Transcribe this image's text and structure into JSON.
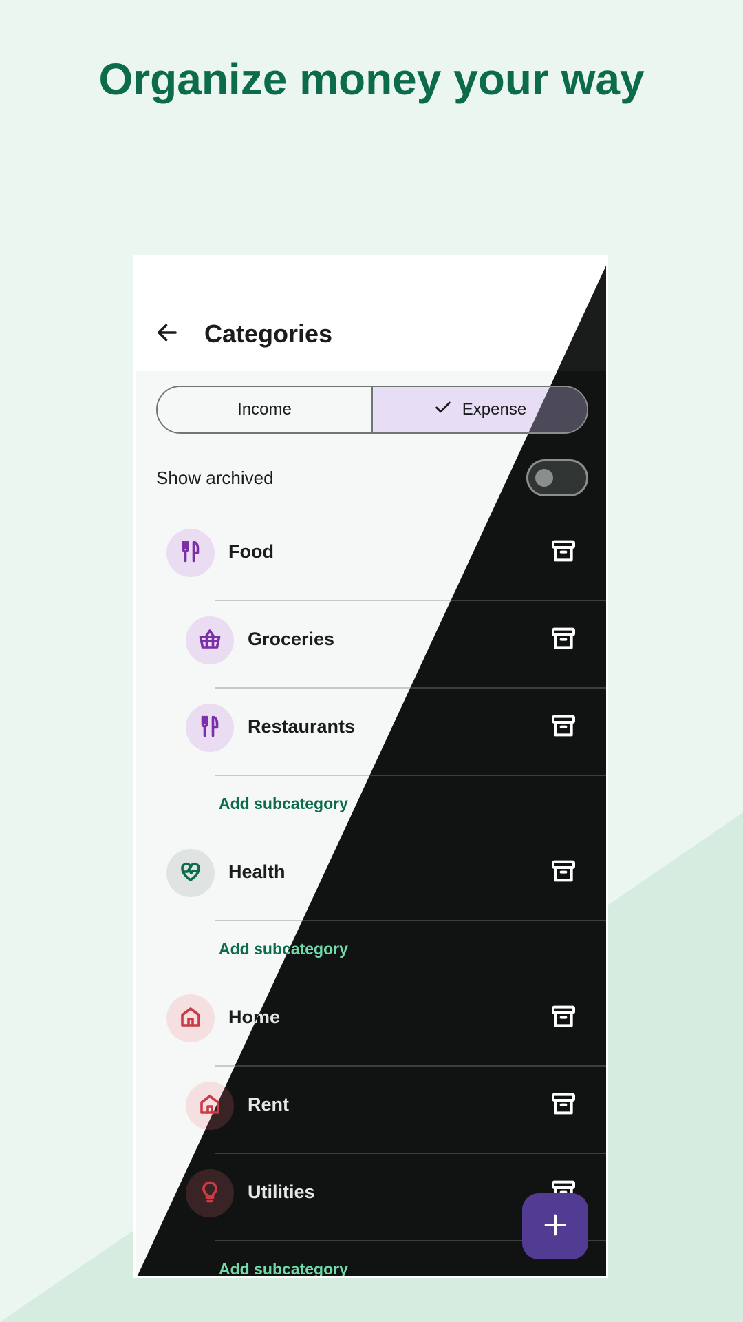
{
  "headline": "Organize money your way",
  "app": {
    "title": "Categories",
    "tabs": {
      "income": "Income",
      "expense": "Expense",
      "selected": "Expense"
    },
    "show_archived": {
      "label": "Show archived",
      "enabled": false
    },
    "add_subcategory_label": "Add subcategory",
    "categories": [
      {
        "name": "Food",
        "icon": "fork-knife-icon",
        "color": "#7b2fa8",
        "bg": "#eadcf1",
        "subcategories": [
          {
            "name": "Groceries",
            "icon": "basket-icon",
            "color": "#7b2fa8",
            "bg": "#eadcf1"
          },
          {
            "name": "Restaurants",
            "icon": "fork-knife-icon",
            "color": "#7b2fa8",
            "bg": "#eadcf1"
          }
        ]
      },
      {
        "name": "Health",
        "icon": "heart-pulse-icon",
        "color": "#0b6b4a",
        "bg": "#dfe4e3",
        "subcategories": []
      },
      {
        "name": "Home",
        "icon": "house-icon",
        "color": "#cc3b45",
        "bg": "#f6dfe0",
        "subcategories": [
          {
            "name": "Rent",
            "icon": "house-icon",
            "color": "#cc3b45",
            "bg": "#f6dfe0"
          },
          {
            "name": "Utilities",
            "icon": "lightbulb-icon",
            "color": "#cc3b45",
            "bg": "#f6dfe0"
          }
        ]
      }
    ],
    "fab_icon": "plus-icon"
  },
  "colors": {
    "brand_green": "#0b6b4a",
    "fab_purple": "#523b93",
    "selected_segment": "#e7def6"
  }
}
